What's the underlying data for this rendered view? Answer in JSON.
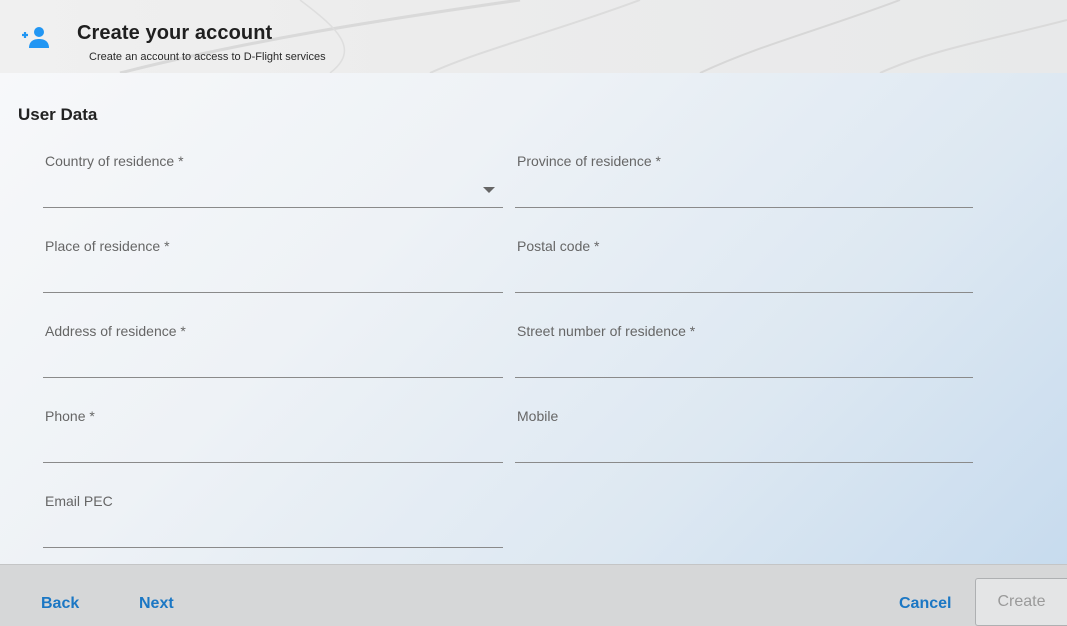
{
  "header": {
    "title": "Create your account",
    "subtitle": "Create an account to access to D-Flight services",
    "icon": "add-user-icon"
  },
  "form": {
    "section_title": "User Data",
    "fields": {
      "country": {
        "label": "Country of residence *",
        "value": ""
      },
      "province": {
        "label": "Province of residence *",
        "value": ""
      },
      "place": {
        "label": "Place of residence *",
        "value": ""
      },
      "postal": {
        "label": "Postal code *",
        "value": ""
      },
      "address": {
        "label": "Address of residence *",
        "value": ""
      },
      "street": {
        "label": "Street number of residence *",
        "value": ""
      },
      "phone": {
        "label": "Phone *",
        "value": ""
      },
      "mobile": {
        "label": "Mobile",
        "value": ""
      },
      "pec": {
        "label": "Email PEC",
        "value": ""
      }
    }
  },
  "footer": {
    "back": "Back",
    "next": "Next",
    "cancel": "Cancel",
    "create": "Create"
  },
  "colors": {
    "accent": "#1b77c4",
    "icon": "#2196f3"
  }
}
